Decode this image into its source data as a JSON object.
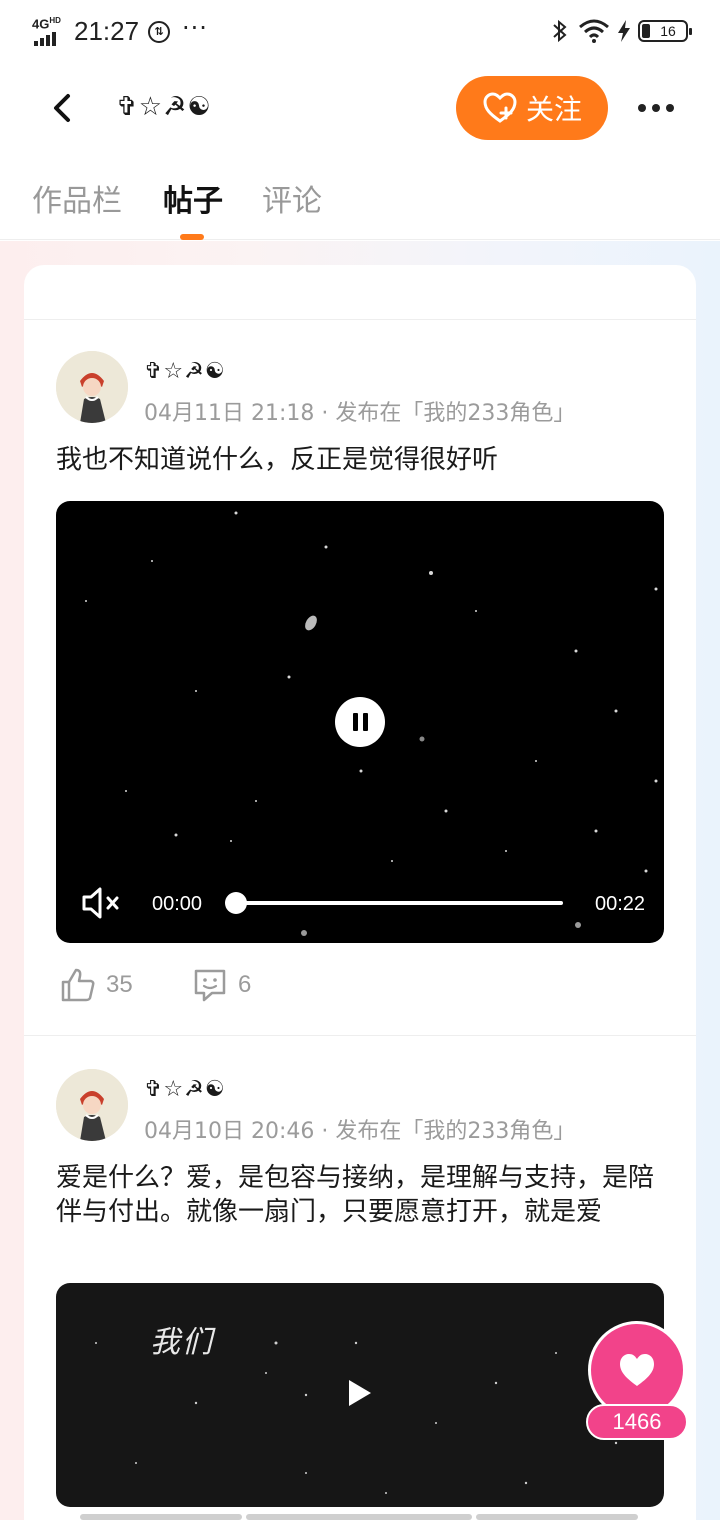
{
  "status_bar": {
    "network": "4G",
    "network_sup": "HD",
    "time": "21:27",
    "icon_left": "data-usage-icon",
    "battery": "16"
  },
  "header": {
    "user_name": "✞☆☭☯",
    "follow_label": "关注"
  },
  "tabs": [
    {
      "label": "作品栏",
      "active": false
    },
    {
      "label": "帖子",
      "active": true
    },
    {
      "label": "评论",
      "active": false
    }
  ],
  "posts": [
    {
      "author": "✞☆☭☯",
      "meta": "04月11日 21:18 · 发布在「我的233角色」",
      "text": "我也不知道说什么，反正是觉得很好听",
      "video": {
        "state": "playing",
        "current_time": "00:00",
        "total_time": "00:22",
        "progress": 0,
        "muted": true
      },
      "likes": "35",
      "comments": "6"
    },
    {
      "author": "✞☆☭☯",
      "meta": "04月10日 20:46 · 发布在「我的233角色」",
      "text": "爱是什么？爱，是包容与接纳，是理解与支持，是陪伴与付出。就像一扇门，只要愿意打开，就是爱",
      "video": {
        "state": "paused",
        "overlay_text": "我们"
      }
    }
  ],
  "floating_like": {
    "count": "1466"
  },
  "colors": {
    "accent": "#ff7a1a",
    "like_pink": "#f2438a",
    "meta_gray": "#9b9b9b"
  }
}
